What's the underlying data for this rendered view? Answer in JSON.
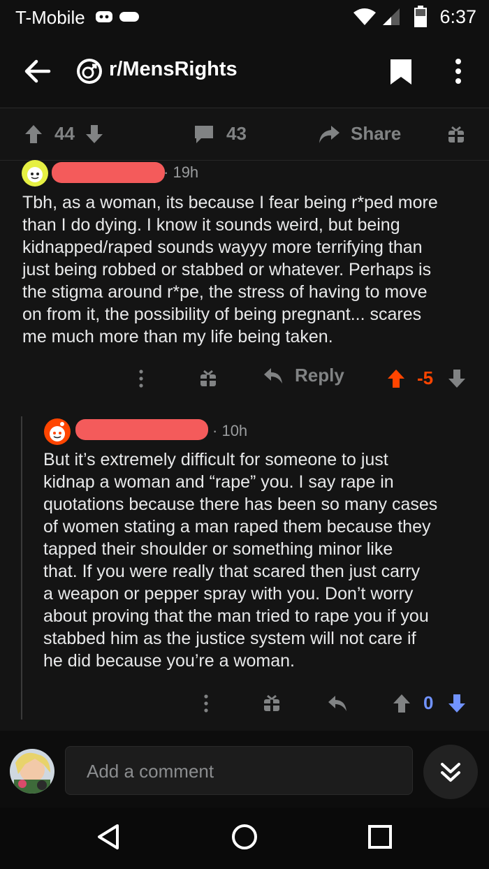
{
  "status_bar": {
    "carrier": "T-Mobile",
    "time": "6:37"
  },
  "header": {
    "subreddit": "r/MensRights"
  },
  "post_actions": {
    "upvotes": "44",
    "comments": "43",
    "share_label": "Share"
  },
  "comments": [
    {
      "author": "",
      "time": "19h",
      "body_lines": [
        "Tbh, as a woman, its because I fear being r*ped more",
        "than I do dying. I know it sounds weird, but being",
        "kidnapped/raped sounds wayyy more terrifying than",
        "just being robbed or stabbed or whatever. Perhaps is",
        "the stigma around r*pe, the stress of having to move",
        "on from it, the possibility of being pregnant... scares",
        "me much more than my life being taken."
      ],
      "reply_label": "Reply",
      "score": "-5"
    },
    {
      "author": "",
      "time": "10h",
      "body_lines": [
        "But it’s extremely difficult for someone to just",
        "kidnap a woman and “rape” you. I say rape in",
        "quotations because there has been so many cases",
        "of women stating a man raped them because they",
        "tapped their shoulder or something minor like",
        "that. If you were really that scared then just carry",
        "a weapon or pepper spray with you. Don’t worry",
        "about proving that the man tried to rape you if you",
        "stabbed him as the justice system will not care if",
        "he did because you’re a woman."
      ],
      "score": "0"
    }
  ],
  "composer": {
    "placeholder": "Add a comment"
  },
  "colors": {
    "upvote_orange": "#ff4500",
    "downvote_blue": "#7193ff",
    "redaction_red": "#f45b5b"
  }
}
